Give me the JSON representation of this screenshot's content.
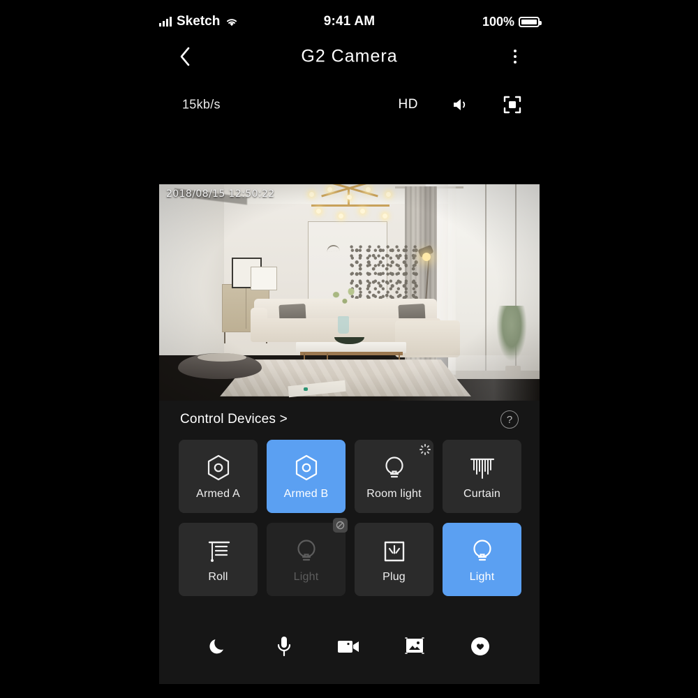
{
  "status_bar": {
    "carrier": "Sketch",
    "time": "9:41 AM",
    "battery_percent": "100%",
    "icons": {
      "signal": "signal-bars-icon",
      "wifi": "wifi-icon",
      "battery": "battery-icon"
    }
  },
  "nav": {
    "back": "back-chevron-icon",
    "title": "G2 Camera",
    "more": "more-vertical-icon"
  },
  "stream_bar": {
    "bitrate": "15kb/s",
    "quality": "HD",
    "sound_icon": "speaker-icon",
    "fullscreen_icon": "fullscreen-icon"
  },
  "video": {
    "timestamp": "2018/08/15 12:50:22",
    "scene": "living-room-camera-feed"
  },
  "control": {
    "title": "Control Devices >",
    "help_icon": "question-mark-icon",
    "devices": [
      {
        "label": "Armed A",
        "icon": "shield-hex-icon",
        "state": "off",
        "badge": "none"
      },
      {
        "label": "Armed B",
        "icon": "shield-hex-icon",
        "state": "active",
        "badge": "none"
      },
      {
        "label": "Room light",
        "icon": "bulb-icon",
        "state": "off",
        "badge": "loading"
      },
      {
        "label": "Curtain",
        "icon": "curtain-icon",
        "state": "off",
        "badge": "none"
      },
      {
        "label": "Roll",
        "icon": "roller-blind-icon",
        "state": "off",
        "badge": "none"
      },
      {
        "label": "Light",
        "icon": "bulb-icon",
        "state": "disabled",
        "badge": "offline"
      },
      {
        "label": "Plug",
        "icon": "socket-icon",
        "state": "off",
        "badge": "none"
      },
      {
        "label": "Light",
        "icon": "bulb-icon",
        "state": "active",
        "badge": "none"
      }
    ]
  },
  "actions": [
    {
      "name": "night-mode",
      "icon": "moon-icon"
    },
    {
      "name": "talk",
      "icon": "microphone-icon"
    },
    {
      "name": "record",
      "icon": "video-camera-icon"
    },
    {
      "name": "screenshot",
      "icon": "image-icon"
    },
    {
      "name": "favorite",
      "icon": "heart-circle-icon"
    }
  ],
  "colors": {
    "background": "#000000",
    "panel": "#161616",
    "tile": "#2b2b2b",
    "tile_disabled": "#232323",
    "accent": "#5ba0f2",
    "text": "#ffffff",
    "text_muted": "#5d5d5d"
  }
}
